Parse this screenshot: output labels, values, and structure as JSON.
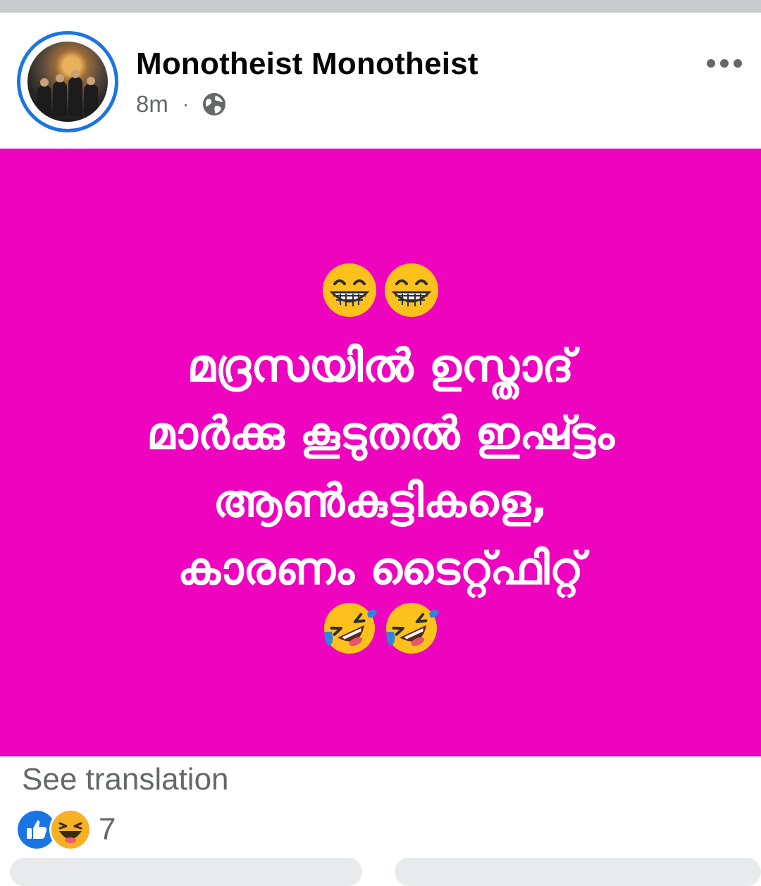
{
  "post": {
    "author_name": "Monotheist Monotheist",
    "timestamp": "8m",
    "separator": "·",
    "privacy_icon": "globe-icon",
    "more_icon": "more-options-icon",
    "background_color": "#ee03be",
    "top_emoji": "grinning-face-with-smiling-eyes",
    "bottom_emoji": "rolling-on-the-floor-laughing",
    "text_lines": [
      "മദ്രസയിൽ ഉസ്താദ്",
      "മാർക്കു കൂടുതൽ ഇഷ്ട്ടം",
      "ആൺകുട്ടികളെ,",
      "കാരണം ടൈറ്റ്ഫിറ്റ്"
    ]
  },
  "footer": {
    "see_translation": "See translation",
    "reaction_icons": [
      "like-icon",
      "haha-icon"
    ],
    "reaction_count": "7"
  }
}
